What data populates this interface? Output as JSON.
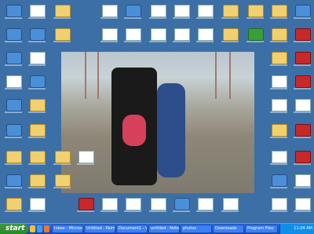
{
  "taskbar": {
    "start_label": "start",
    "tasks": [
      {
        "label": "Inbox - Microsoft ..."
      },
      {
        "label": "Untitled - Paint"
      },
      {
        "label": "Document1 - Word"
      },
      {
        "label": "untitled - Notepad"
      },
      {
        "label": "photos"
      },
      {
        "label": "Downloads"
      },
      {
        "label": "Program Files"
      }
    ],
    "clock": "11:04 AM"
  }
}
